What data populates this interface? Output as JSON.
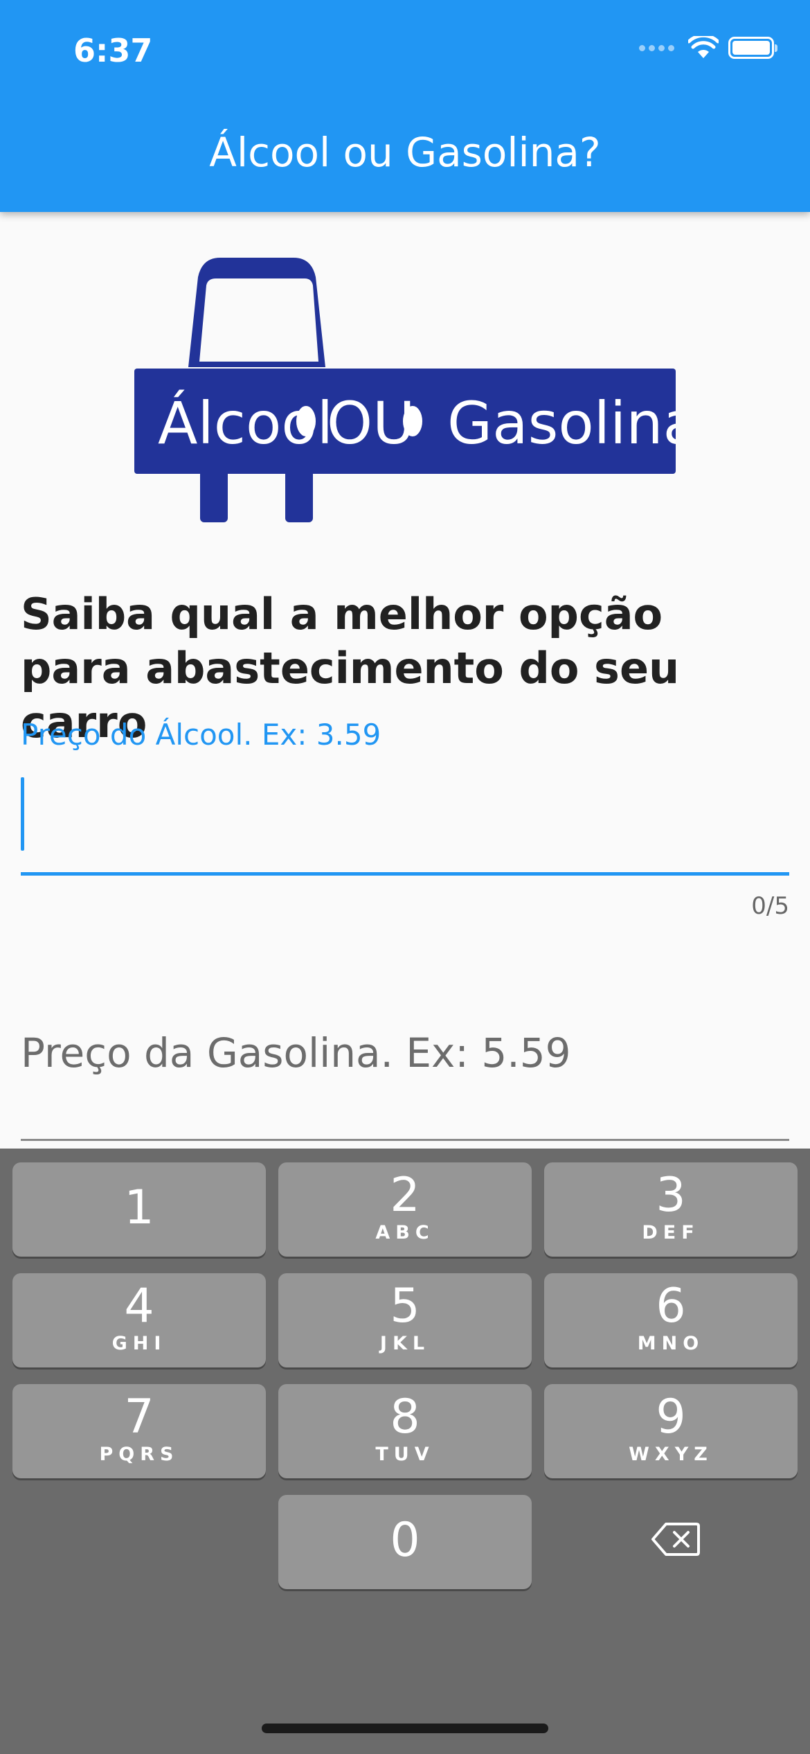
{
  "status_bar": {
    "time": "6:37"
  },
  "appbar": {
    "title": "Álcool ou Gasolina?"
  },
  "logo": {
    "brand_color": "#223399",
    "text_left": "Álcool",
    "text_mid": "OU",
    "text_right": "Gasolina"
  },
  "headline": "Saiba qual a melhor opção para abastecimento do seu carro",
  "alcohol_field": {
    "label": "Preço do Álcool. Ex: 3.59",
    "value": "",
    "counter": "0/5"
  },
  "gas_field": {
    "placeholder": "Preço da Gasolina. Ex: 5.59",
    "value": ""
  },
  "colors": {
    "primary": "#2196f3",
    "keyboard_bg": "#6b6b6b",
    "key_bg": "#969696"
  },
  "keyboard": {
    "keys": [
      {
        "digit": "1",
        "letters": ""
      },
      {
        "digit": "2",
        "letters": "ABC"
      },
      {
        "digit": "3",
        "letters": "DEF"
      },
      {
        "digit": "4",
        "letters": "GHI"
      },
      {
        "digit": "5",
        "letters": "JKL"
      },
      {
        "digit": "6",
        "letters": "MNO"
      },
      {
        "digit": "7",
        "letters": "PQRS"
      },
      {
        "digit": "8",
        "letters": "TUV"
      },
      {
        "digit": "9",
        "letters": "WXYZ"
      },
      {
        "digit": "0",
        "letters": ""
      }
    ],
    "delete_icon": "backspace-icon"
  }
}
